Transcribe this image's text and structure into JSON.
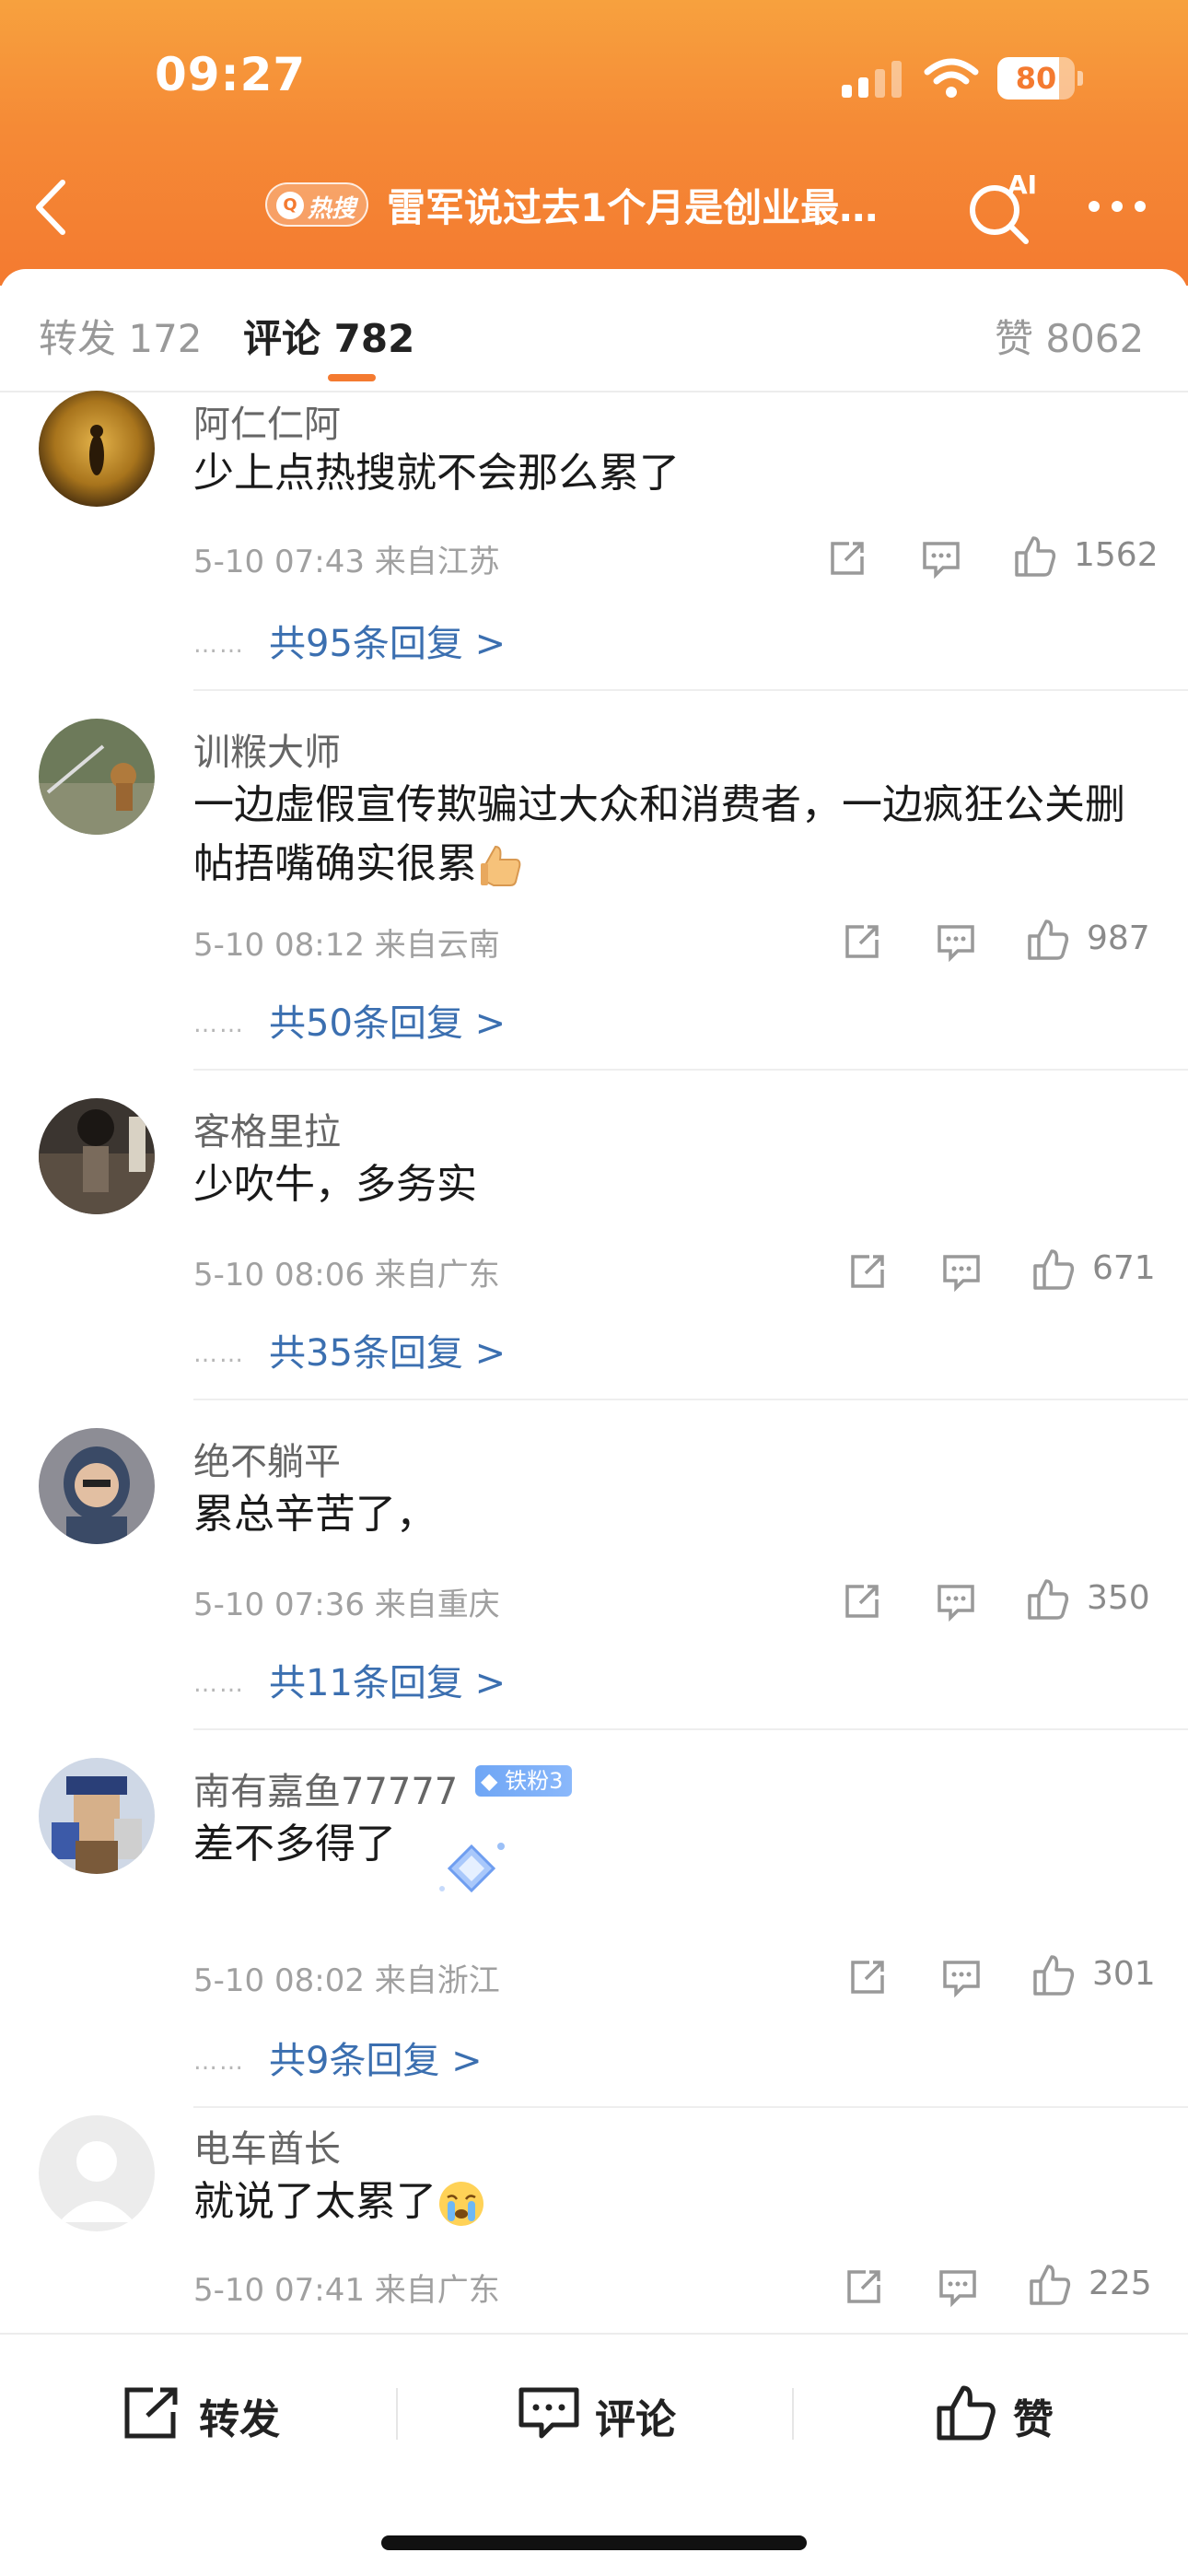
{
  "status_bar": {
    "time": "09:27",
    "battery": "80",
    "battery_level": 0.8
  },
  "nav": {
    "hot_badge": "热搜",
    "hot_lens": "Q",
    "title": "雷军说过去1个月是创业最…",
    "ai_label": "AI"
  },
  "tabs": {
    "forward": "转发 172",
    "comments": "评论 782",
    "likes": "赞 8062"
  },
  "comments": [
    {
      "user": "阿仁仁阿",
      "text": "少上点热搜就不会那么累了",
      "time": "5-10 07:43",
      "location": "来自江苏",
      "likes": "1562",
      "replies": "共95条回复 >"
    },
    {
      "user": "训糇大师",
      "text": "一边虚假宣传欺骗过大众和消费者，一边疯狂公关删帖捂嘴确实很累",
      "time": "5-10 08:12",
      "location": "来自云南",
      "likes": "987",
      "replies": "共50条回复 >"
    },
    {
      "user": "客格里拉",
      "text": "少吹牛，多务实",
      "time": "5-10 08:06",
      "location": "来自广东",
      "likes": "671",
      "replies": "共35条回复 >"
    },
    {
      "user": "绝不躺平",
      "text": "累总辛苦了，",
      "time": "5-10 07:36",
      "location": "来自重庆",
      "likes": "350",
      "replies": "共11条回复 >"
    },
    {
      "user": "南有嘉鱼77777",
      "badge": "铁粉3",
      "text": "差不多得了",
      "time": "5-10 08:02",
      "location": "来自浙江",
      "likes": "301",
      "replies": "共9条回复 >"
    },
    {
      "user": "电车酋长",
      "text": "就说了太累了",
      "time": "5-10 07:41",
      "location": "来自广东",
      "likes": "225"
    }
  ],
  "reply_dots": "……",
  "bottom_bar": {
    "forward": "转发",
    "comment": "评论",
    "like": "赞"
  }
}
